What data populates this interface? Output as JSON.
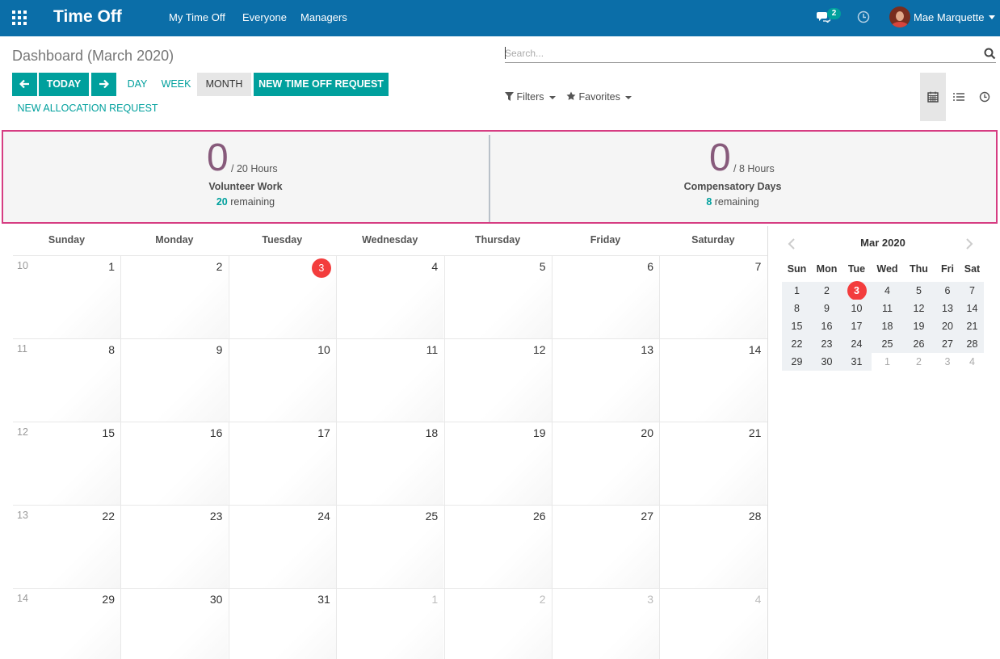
{
  "navbar": {
    "app_title": "Time Off",
    "menu": [
      "My Time Off",
      "Everyone",
      "Managers"
    ],
    "chat_count": "2",
    "user_name": "Mae Marquette"
  },
  "control_panel": {
    "breadcrumb": "Dashboard (March 2020)",
    "search_placeholder": "Search...",
    "today_label": "TODAY",
    "day_label": "DAY",
    "week_label": "WEEK",
    "month_label": "MONTH",
    "new_time_off_label": "NEW TIME OFF REQUEST",
    "new_allocation_label": "NEW ALLOCATION REQUEST",
    "filters_label": "Filters",
    "favorites_label": "Favorites"
  },
  "dashboard": {
    "cards": [
      {
        "taken": "0",
        "total": "/ 20 Hours",
        "type": "Volunteer Work",
        "remaining_value": "20",
        "remaining_label": "remaining"
      },
      {
        "taken": "0",
        "total": "/ 8 Hours",
        "type": "Compensatory Days",
        "remaining_value": "8",
        "remaining_label": "remaining"
      }
    ]
  },
  "calendar": {
    "days_of_week": [
      "Sunday",
      "Monday",
      "Tuesday",
      "Wednesday",
      "Thursday",
      "Friday",
      "Saturday"
    ],
    "weeks": [
      {
        "week_number": "10",
        "days": [
          "1",
          "2",
          "3",
          "4",
          "5",
          "6",
          "7"
        ]
      },
      {
        "week_number": "11",
        "days": [
          "8",
          "9",
          "10",
          "11",
          "12",
          "13",
          "14"
        ]
      },
      {
        "week_number": "12",
        "days": [
          "15",
          "16",
          "17",
          "18",
          "19",
          "20",
          "21"
        ]
      },
      {
        "week_number": "13",
        "days": [
          "22",
          "23",
          "24",
          "25",
          "26",
          "27",
          "28"
        ]
      },
      {
        "week_number": "14",
        "days": [
          "29",
          "30",
          "31",
          "1",
          "2",
          "3",
          "4"
        ]
      }
    ],
    "today": "3",
    "accent_today": "#f33d3d"
  },
  "mini_calendar": {
    "title": "Mar 2020",
    "days_of_week": [
      "Sun",
      "Mon",
      "Tue",
      "Wed",
      "Thu",
      "Fri",
      "Sat"
    ],
    "weeks": [
      [
        "1",
        "2",
        "3",
        "4",
        "5",
        "6",
        "7"
      ],
      [
        "8",
        "9",
        "10",
        "11",
        "12",
        "13",
        "14"
      ],
      [
        "15",
        "16",
        "17",
        "18",
        "19",
        "20",
        "21"
      ],
      [
        "22",
        "23",
        "24",
        "25",
        "26",
        "27",
        "28"
      ],
      [
        "29",
        "30",
        "31",
        "1",
        "2",
        "3",
        "4"
      ]
    ]
  },
  "colors": {
    "navbar": "#0b6ea8",
    "primary": "#00a09d",
    "dashboard_border": "#d63d82",
    "big_number": "#875a7b"
  }
}
